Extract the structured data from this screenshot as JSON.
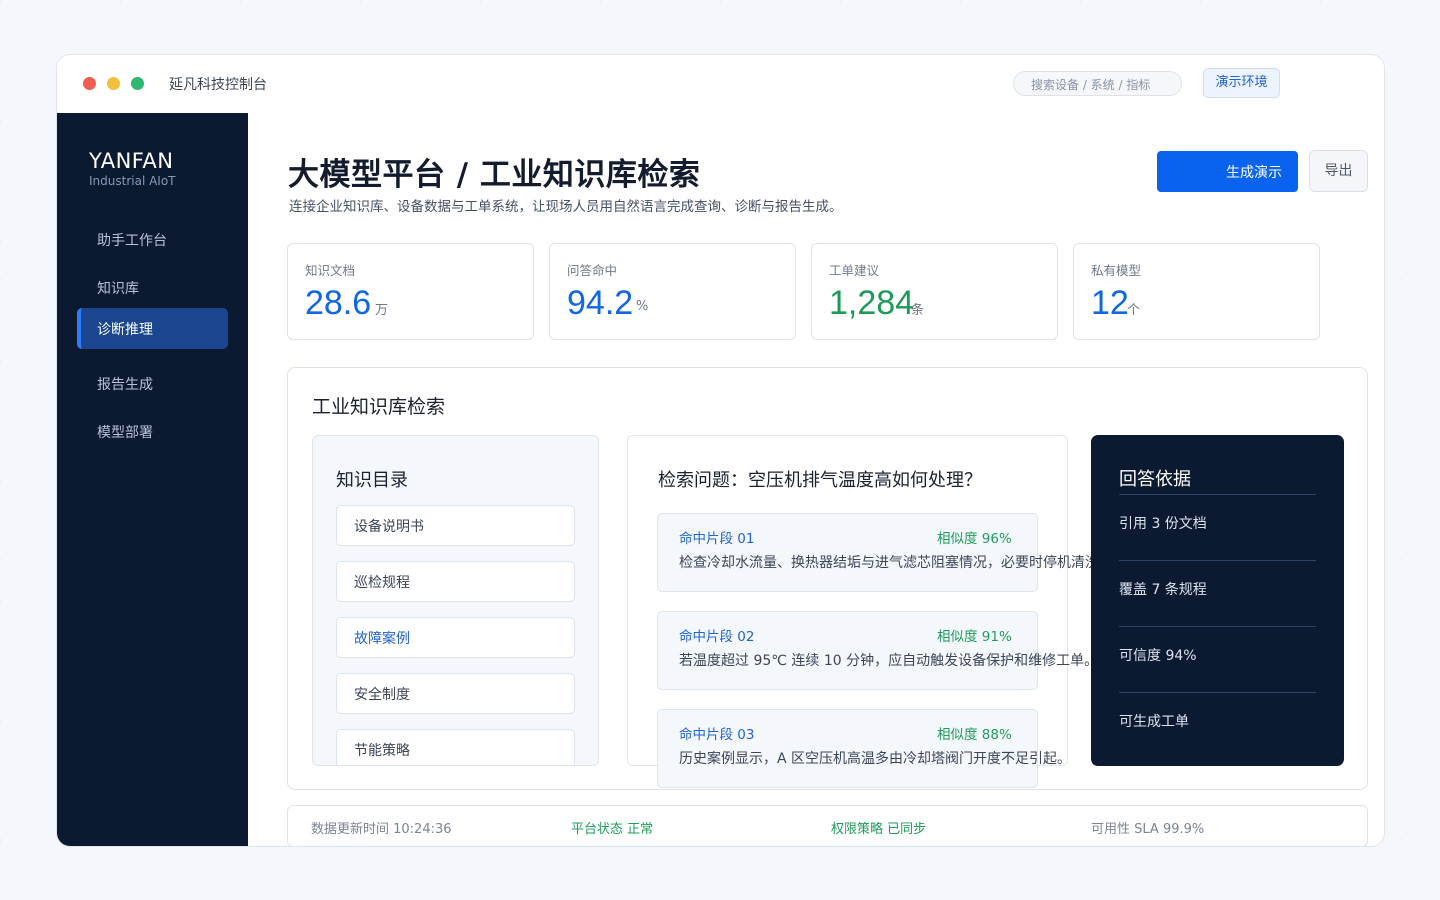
{
  "window": {
    "title": "延凡科技控制台",
    "search_placeholder": "搜索设备 / 系统 / 指标",
    "env_badge": "演示环境"
  },
  "sidebar": {
    "brand": "YANFAN",
    "brand_sub": "Industrial AIoT",
    "items": [
      {
        "label": "助手工作台"
      },
      {
        "label": "知识库"
      },
      {
        "label": "诊断推理",
        "active": true
      },
      {
        "label": "报告生成"
      },
      {
        "label": "模型部署"
      }
    ]
  },
  "header": {
    "title": "大模型平台 / 工业知识库检索",
    "subtitle": "连接企业知识库、设备数据与工单系统，让现场人员用自然语言完成查询、诊断与报告生成。",
    "primary_button": "生成演示",
    "export_button": "导出"
  },
  "stats": [
    {
      "label": "知识文档",
      "value": "28.6",
      "unit": "万",
      "color": "#0f66e6"
    },
    {
      "label": "问答命中",
      "value": "94.2",
      "unit": "%",
      "color": "#0f66e6"
    },
    {
      "label": "工单建议",
      "value": "1,284",
      "unit": "条",
      "color": "#1e9a58"
    },
    {
      "label": "私有模型",
      "value": "12",
      "unit": "个",
      "color": "#0f66e6"
    }
  ],
  "panel": {
    "title": "工业知识库检索",
    "catalog": {
      "title": "知识目录",
      "items": [
        {
          "label": "设备说明书"
        },
        {
          "label": "巡检规程"
        },
        {
          "label": "故障案例",
          "active": true
        },
        {
          "label": "安全制度"
        },
        {
          "label": "节能策略"
        }
      ]
    },
    "results": {
      "title": "检索问题：空压机排气温度高如何处理？",
      "hits": [
        {
          "label": "命中片段 01",
          "score": "相似度 96%",
          "text": "检查冷却水流量、换热器结垢与进气滤芯阻塞情况，必要时停机清洗。"
        },
        {
          "label": "命中片段 02",
          "score": "相似度 91%",
          "text": "若温度超过 95℃ 连续 10 分钟，应自动触发设备保护和维修工单。"
        },
        {
          "label": "命中片段 03",
          "score": "相似度 88%",
          "text": "历史案例显示，A 区空压机高温多由冷却塔阀门开度不足引起。"
        }
      ]
    },
    "evidence": {
      "title": "回答依据",
      "items": [
        "引用 3 份文档",
        "覆盖 7 条规程",
        "可信度 94%",
        "可生成工单"
      ]
    }
  },
  "footer": {
    "updated": "数据更新时间 10:24:36",
    "platform": "平台状态 正常",
    "policy": "权限策略 已同步",
    "sla": "可用性 SLA 99.9%"
  }
}
